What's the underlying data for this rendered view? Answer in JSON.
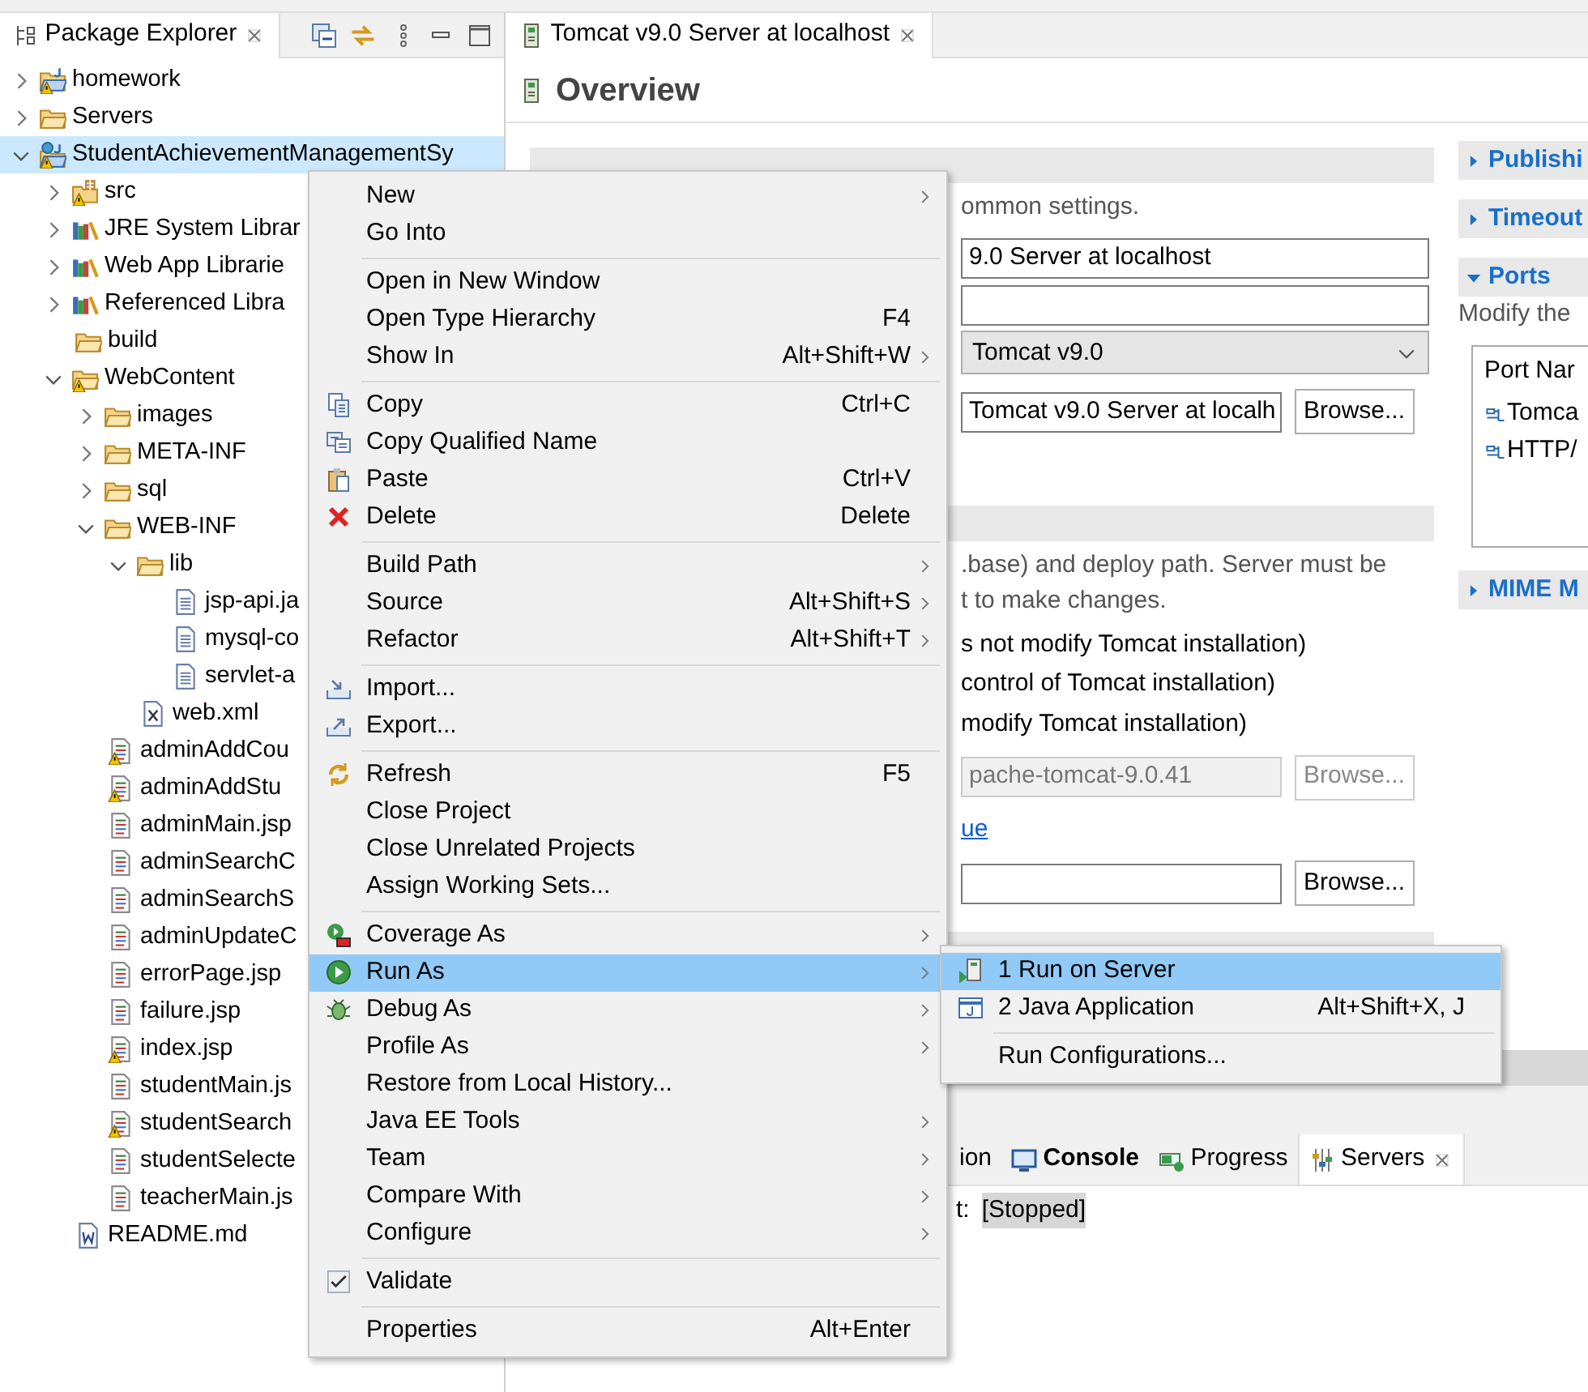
{
  "package_explorer": {
    "title": "Package Explorer"
  },
  "tree": [
    {
      "label": "homework",
      "kind": "project",
      "warning": true,
      "expanded": false,
      "selected": false
    },
    {
      "label": "Servers",
      "kind": "folder",
      "warning": false,
      "expanded": false,
      "selected": false
    },
    {
      "label": "StudentAchievementManagementSy",
      "kind": "web_project",
      "warning": true,
      "expanded": true,
      "selected": true,
      "children": [
        {
          "label": "src",
          "kind": "source",
          "warning": true,
          "expanded": false,
          "selected": false
        },
        {
          "label": "JRE System Librar",
          "kind": "library",
          "warning": false,
          "expanded": false,
          "selected": false
        },
        {
          "label": "Web App Librarie",
          "kind": "library",
          "warning": false,
          "expanded": false,
          "selected": false
        },
        {
          "label": "Referenced Libra",
          "kind": "library",
          "warning": false,
          "expanded": false,
          "selected": false
        },
        {
          "label": "build",
          "kind": "folder",
          "warning": false,
          "selected": false
        },
        {
          "label": "WebContent",
          "kind": "folder",
          "warning": true,
          "expanded": true,
          "selected": false,
          "children": [
            {
              "label": "images",
              "kind": "folder",
              "warning": false,
              "expanded": false,
              "selected": false
            },
            {
              "label": "META-INF",
              "kind": "folder",
              "warning": false,
              "expanded": false,
              "selected": false
            },
            {
              "label": "sql",
              "kind": "folder",
              "warning": false,
              "expanded": false,
              "selected": false
            },
            {
              "label": "WEB-INF",
              "kind": "folder",
              "warning": false,
              "expanded": true,
              "selected": false,
              "children": [
                {
                  "label": "lib",
                  "kind": "folder",
                  "warning": false,
                  "expanded": true,
                  "selected": false,
                  "children": [
                    {
                      "label": "jsp-api.ja",
                      "kind": "jar",
                      "warning": false,
                      "selected": false
                    },
                    {
                      "label": "mysql-co",
                      "kind": "jar",
                      "warning": false,
                      "selected": false
                    },
                    {
                      "label": "servlet-a",
                      "kind": "jar",
                      "warning": false,
                      "selected": false
                    }
                  ]
                },
                {
                  "label": "web.xml",
                  "kind": "xml",
                  "warning": false,
                  "selected": false
                }
              ]
            },
            {
              "label": "adminAddCou",
              "kind": "jsp",
              "warning": true,
              "selected": false
            },
            {
              "label": "adminAddStu",
              "kind": "jsp",
              "warning": true,
              "selected": false
            },
            {
              "label": "adminMain.jsp",
              "kind": "jsp",
              "warning": false,
              "selected": false
            },
            {
              "label": "adminSearchC",
              "kind": "jsp",
              "warning": false,
              "selected": false
            },
            {
              "label": "adminSearchS",
              "kind": "jsp",
              "warning": false,
              "selected": false
            },
            {
              "label": "adminUpdateC",
              "kind": "jsp",
              "warning": false,
              "selected": false
            },
            {
              "label": "errorPage.jsp",
              "kind": "jsp",
              "warning": false,
              "selected": false
            },
            {
              "label": "failure.jsp",
              "kind": "jsp",
              "warning": false,
              "selected": false
            },
            {
              "label": "index.jsp",
              "kind": "jsp",
              "warning": true,
              "selected": false
            },
            {
              "label": "studentMain.js",
              "kind": "jsp",
              "warning": false,
              "selected": false
            },
            {
              "label": "studentSearch",
              "kind": "jsp",
              "warning": true,
              "selected": false
            },
            {
              "label": "studentSelecte",
              "kind": "jsp",
              "warning": false,
              "selected": false
            },
            {
              "label": "teacherMain.js",
              "kind": "jsp",
              "warning": false,
              "selected": false
            }
          ]
        },
        {
          "label": "README.md",
          "kind": "text_file",
          "warning": false,
          "selected": false
        }
      ]
    }
  ],
  "editor": {
    "tab": "Tomcat v9.0 Server at localhost",
    "heading": "Overview",
    "general": {
      "description": "ommon settings.",
      "fields": [
        {
          "kind": "text",
          "value": "9.0 Server at localhost"
        },
        {
          "kind": "text"
        },
        {
          "kind": "select",
          "value": "Tomcat v9.0"
        },
        {
          "kind": "text",
          "value": "Tomcat v9.0 Server at localh",
          "button": "Browse..."
        }
      ]
    },
    "locations": {
      "description": [
        ".base) and deploy path. Server must be",
        "t to make changes."
      ],
      "options": [
        "s not modify Tomcat installation)",
        "control of Tomcat installation)",
        "modify Tomcat installation)"
      ],
      "fields": [
        {
          "kind": "text",
          "value": "pache-tomcat-9.0.41",
          "disabled": true,
          "button": "Browse..."
        },
        {
          "kind": "link",
          "value": "ue"
        },
        {
          "kind": "text",
          "disabled": false,
          "button": "Browse..."
        }
      ]
    },
    "side_sections": [
      {
        "title": "Publishi",
        "expanded": false
      },
      {
        "title": "Timeout",
        "expanded": false
      },
      {
        "title": "Ports",
        "expanded": true,
        "description": "Modify the",
        "table": {
          "columns": [
            "Port Nar"
          ],
          "rows": [
            "Tomca",
            "HTTP/"
          ]
        }
      },
      {
        "title": "MIME M",
        "expanded": false
      }
    ]
  },
  "bottom_panel": {
    "tabs": [
      {
        "label": "ion",
        "kind": "plain",
        "bold": false,
        "selected": false
      },
      {
        "label": "Console",
        "kind": "console",
        "bold": true,
        "selected": false
      },
      {
        "label": "Progress",
        "kind": "progress",
        "bold": false,
        "selected": false
      },
      {
        "label": "Servers",
        "kind": "servers",
        "bold": false,
        "selected": true
      }
    ],
    "content": [
      {
        "text": "t:",
        "highlighted": false
      },
      {
        "text": "[Stopped]",
        "highlighted": true
      }
    ]
  },
  "context_menu": {
    "items": [
      {
        "kind": "item",
        "label": "New",
        "submenu": true,
        "selected": false
      },
      {
        "kind": "item",
        "label": "Go Into",
        "selected": false
      },
      {
        "kind": "separator"
      },
      {
        "kind": "item",
        "label": "Open in New Window",
        "selected": false
      },
      {
        "kind": "item",
        "label": "Open Type Hierarchy",
        "shortcut": "F4",
        "selected": false
      },
      {
        "kind": "item",
        "label": "Show In",
        "shortcut": "Alt+Shift+W",
        "submenu": true,
        "selected": false
      },
      {
        "kind": "separator"
      },
      {
        "kind": "copy",
        "label": "Copy",
        "shortcut": "Ctrl+C",
        "selected": false
      },
      {
        "kind": "copy_qualified",
        "label": "Copy Qualified Name",
        "selected": false
      },
      {
        "kind": "paste",
        "label": "Paste",
        "shortcut": "Ctrl+V",
        "selected": false
      },
      {
        "kind": "delete",
        "label": "Delete",
        "shortcut": "Delete",
        "selected": false
      },
      {
        "kind": "separator"
      },
      {
        "kind": "item",
        "label": "Build Path",
        "submenu": true,
        "selected": false
      },
      {
        "kind": "item",
        "label": "Source",
        "shortcut": "Alt+Shift+S",
        "submenu": true,
        "selected": false
      },
      {
        "kind": "item",
        "label": "Refactor",
        "shortcut": "Alt+Shift+T",
        "submenu": true,
        "selected": false
      },
      {
        "kind": "separator"
      },
      {
        "kind": "import",
        "label": "Import...",
        "selected": false
      },
      {
        "kind": "export",
        "label": "Export...",
        "selected": false
      },
      {
        "kind": "separator"
      },
      {
        "kind": "refresh",
        "label": "Refresh",
        "shortcut": "F5",
        "selected": false
      },
      {
        "kind": "item",
        "label": "Close Project",
        "selected": false
      },
      {
        "kind": "item",
        "label": "Close Unrelated Projects",
        "selected": false
      },
      {
        "kind": "item",
        "label": "Assign Working Sets...",
        "selected": false
      },
      {
        "kind": "separator"
      },
      {
        "kind": "coverage",
        "label": "Coverage As",
        "submenu": true,
        "selected": false
      },
      {
        "kind": "run",
        "label": "Run As",
        "submenu": true,
        "selected": true
      },
      {
        "kind": "debug",
        "label": "Debug As",
        "submenu": true,
        "selected": false
      },
      {
        "kind": "item",
        "label": "Profile As",
        "submenu": true,
        "selected": false
      },
      {
        "kind": "item",
        "label": "Restore from Local History...",
        "selected": false
      },
      {
        "kind": "item",
        "label": "Java EE Tools",
        "submenu": true,
        "selected": false
      },
      {
        "kind": "item",
        "label": "Team",
        "submenu": true,
        "selected": false
      },
      {
        "kind": "item",
        "label": "Compare With",
        "submenu": true,
        "selected": false
      },
      {
        "kind": "item",
        "label": "Configure",
        "submenu": true,
        "selected": false
      },
      {
        "kind": "separator"
      },
      {
        "kind": "check",
        "label": "Validate",
        "checked": true,
        "selected": false
      },
      {
        "kind": "separator"
      },
      {
        "kind": "item",
        "label": "Properties",
        "shortcut": "Alt+Enter",
        "selected": false
      }
    ]
  },
  "run_as_menu": {
    "items": [
      {
        "kind": "server",
        "label": "1 Run on Server",
        "selected": true
      },
      {
        "kind": "java",
        "label": "2 Java Application",
        "shortcut": "Alt+Shift+X, J",
        "selected": false
      },
      {
        "kind": "separator"
      },
      {
        "kind": "item",
        "label": "Run Configurations...",
        "selected": false
      }
    ]
  }
}
